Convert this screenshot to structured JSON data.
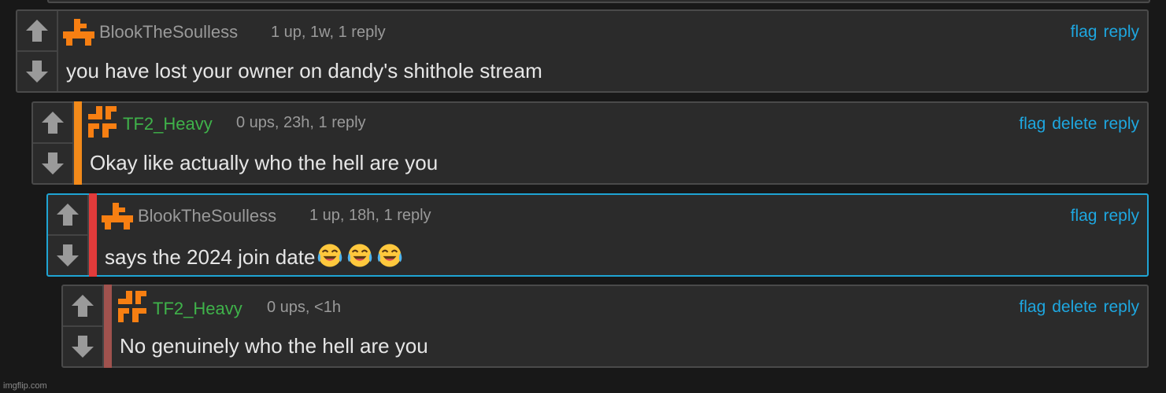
{
  "colors": {
    "background": "#181818",
    "panel": "#2b2b2b",
    "link": "#1ea7e0",
    "highlight_border": "#1fa4d4",
    "avatar_orange": "#f77f12",
    "username_gray": "#9a9a9a",
    "username_green": "#3fb24a"
  },
  "comments": [
    {
      "username": "BlookTheSoulless",
      "username_color": "gray",
      "avatar_icon": "orange-stairs-icon",
      "meta": "1 up, 1w, 1 reply",
      "actions": [
        "flag",
        "reply"
      ],
      "text": "you have lost your owner on dandy's shithole stream",
      "side_bar_color": ""
    },
    {
      "username": "TF2_Heavy",
      "username_color": "green",
      "avatar_icon": "orange-swirl-icon",
      "meta": "0 ups, 23h, 1 reply",
      "actions": [
        "flag",
        "delete",
        "reply"
      ],
      "text": "Okay like actually who the hell are you",
      "side_bar_color": "#f28a1a"
    },
    {
      "username": "BlookTheSoulless",
      "username_color": "gray",
      "avatar_icon": "orange-stairs-icon",
      "meta": "1 up, 18h, 1 reply",
      "actions": [
        "flag",
        "reply"
      ],
      "text": "says the 2024 join date",
      "text_emoji": [
        "face-with-tears-of-joy",
        "face-with-tears-of-joy",
        "face-with-tears-of-joy"
      ],
      "side_bar_color": "#e23b3b",
      "highlighted": true
    },
    {
      "username": "TF2_Heavy",
      "username_color": "green",
      "avatar_icon": "orange-swirl-icon",
      "meta": "0 ups, <1h",
      "actions": [
        "flag",
        "delete",
        "reply"
      ],
      "text": "No genuinely who the hell are you",
      "side_bar_color": "#a0524e"
    }
  ],
  "watermark": "imgflip.com"
}
